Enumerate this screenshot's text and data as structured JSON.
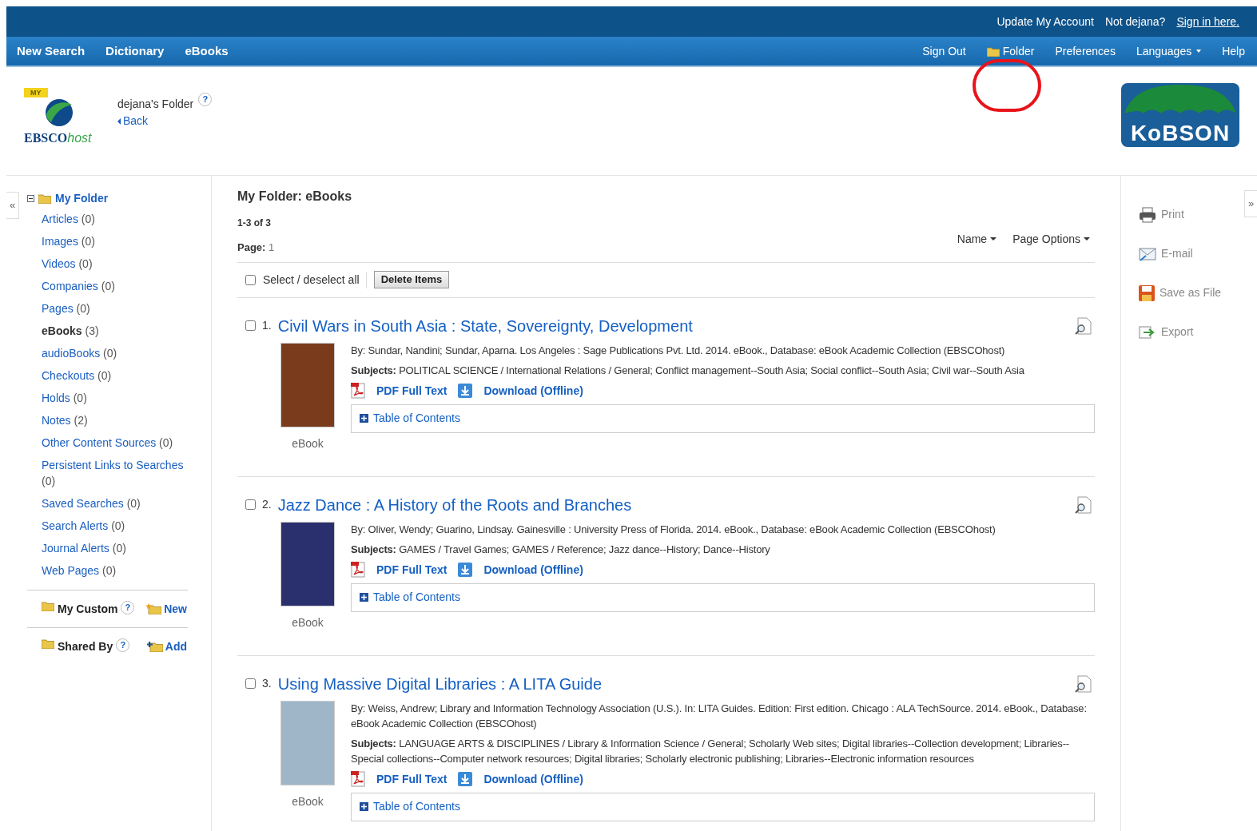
{
  "top_links": [
    {
      "text": "Update My Account",
      "kind": "plain"
    },
    {
      "text": "Not dejana?",
      "kind": "plain"
    },
    {
      "text": "Sign in here.",
      "kind": "link"
    }
  ],
  "nav_left": [
    "New Search",
    "Dictionary",
    "eBooks"
  ],
  "nav_right": [
    {
      "label": "Sign Out",
      "kind": "plain"
    },
    {
      "label": "Folder",
      "kind": "folder"
    },
    {
      "label": "Preferences",
      "kind": "plain"
    },
    {
      "label": "Languages",
      "kind": "dropdown"
    },
    {
      "label": "Help",
      "kind": "plain"
    }
  ],
  "header": {
    "logo_badge": "MY",
    "logo_text": "EBSCO",
    "logo_suffix": "host",
    "folder_title": "dejana's Folder",
    "back": "Back",
    "help_mark": "?",
    "library_logo": "KoBSON"
  },
  "annotation": {
    "kind": "circle",
    "color": "#e8141b"
  },
  "sidebar": {
    "collapse": "«",
    "tree": {
      "label": "My Folder",
      "expanded": true,
      "children": [
        {
          "label": "Articles",
          "count": "(0)",
          "selected": false
        },
        {
          "label": "Images",
          "count": "(0)",
          "selected": false
        },
        {
          "label": "Videos",
          "count": "(0)",
          "selected": false
        },
        {
          "label": "Companies",
          "count": "(0)",
          "selected": false
        },
        {
          "label": "Pages",
          "count": "(0)",
          "selected": false
        },
        {
          "label": "eBooks",
          "count": "(3)",
          "selected": true
        },
        {
          "label": "audioBooks",
          "count": "(0)",
          "selected": false
        },
        {
          "label": "Checkouts",
          "count": "(0)",
          "selected": false
        },
        {
          "label": "Holds",
          "count": "(0)",
          "selected": false
        },
        {
          "label": "Notes",
          "count": "(2)",
          "selected": false
        },
        {
          "label": "Other Content Sources",
          "count": "(0)",
          "selected": false
        },
        {
          "label": "Persistent Links to Searches",
          "count": "(0)",
          "selected": false
        },
        {
          "label": "Saved Searches",
          "count": "(0)",
          "selected": false
        },
        {
          "label": "Search Alerts",
          "count": "(0)",
          "selected": false
        },
        {
          "label": "Journal Alerts",
          "count": "(0)",
          "selected": false
        },
        {
          "label": "Web Pages",
          "count": "(0)",
          "selected": false
        }
      ]
    },
    "sections": [
      {
        "label": "My Custom",
        "help": "?",
        "action": "New",
        "kind": "new"
      },
      {
        "label": "Shared By",
        "help": "?",
        "action": "Add",
        "kind": "add"
      }
    ]
  },
  "main": {
    "heading": "My Folder: eBooks",
    "count": "1-3 of 3",
    "page_label": "Page:",
    "page": "1",
    "sort": "Name",
    "page_options": "Page Options",
    "select_all": {
      "label": "Select / deselect all",
      "checked": false
    },
    "delete": "Delete Items",
    "results": [
      {
        "number": "1.",
        "title": "Civil Wars in South Asia : State, Sovereignty, Development",
        "checked": false,
        "byline": "By: Sundar, Nandini; Sundar, Aparna. Los Angeles : Sage Publications Pvt. Ltd. 2014. eBook., Database: eBook Academic Collection (EBSCOhost)",
        "subjects_label": "Subjects:",
        "subjects": "POLITICAL SCIENCE / International Relations / General; Conflict management--South Asia; Social conflict--South Asia; Civil war--South Asia",
        "pdf": "PDF Full Text",
        "download": "Download (Offline)",
        "toc": "Table of Contents",
        "type": "eBook",
        "color": "#7a3b1c"
      },
      {
        "number": "2.",
        "title": "Jazz Dance : A History of the Roots and Branches",
        "checked": false,
        "byline": "By: Oliver, Wendy; Guarino, Lindsay. Gainesville : University Press of Florida. 2014. eBook., Database: eBook Academic Collection (EBSCOhost)",
        "subjects_label": "Subjects:",
        "subjects": "GAMES / Travel Games; GAMES / Reference; Jazz dance--History; Dance--History",
        "pdf": "PDF Full Text",
        "download": "Download (Offline)",
        "toc": "Table of Contents",
        "type": "eBook",
        "color": "#2a2f6e"
      },
      {
        "number": "3.",
        "title": "Using Massive Digital Libraries : A LITA Guide",
        "checked": false,
        "byline": "By: Weiss, Andrew; Library and Information Technology Association (U.S.). In: LITA Guides. Edition: First edition. Chicago : ALA TechSource. 2014. eBook., Database: eBook Academic Collection (EBSCOhost)",
        "subjects_label": "Subjects:",
        "subjects": "LANGUAGE ARTS & DISCIPLINES / Library & Information Science / General; Scholarly Web sites; Digital libraries--Collection development; Libraries--Special collections--Computer network resources; Digital libraries; Scholarly electronic publishing; Libraries--Electronic information resources",
        "pdf": "PDF Full Text",
        "download": "Download (Offline)",
        "toc": "Table of Contents",
        "type": "eBook",
        "color": "#9fb6c9"
      }
    ]
  },
  "tools": {
    "expand": "»",
    "items": [
      {
        "label": "Print",
        "kind": "print"
      },
      {
        "label": "E-mail",
        "kind": "email"
      },
      {
        "label": "Save as File",
        "kind": "save"
      },
      {
        "label": "Export",
        "kind": "export"
      }
    ]
  }
}
